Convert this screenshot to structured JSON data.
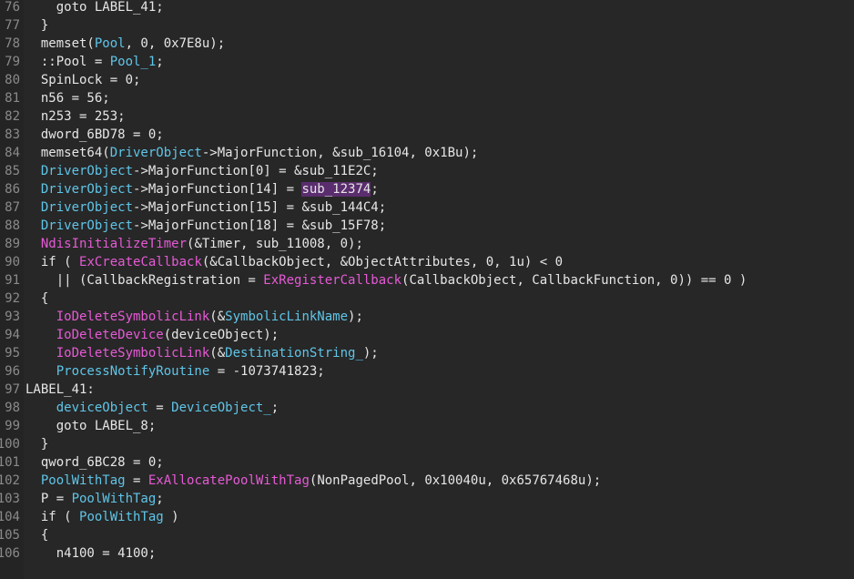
{
  "colors": {
    "background": "#272727",
    "plain": "#e6e6e6",
    "variable": "#5fc5e8",
    "function": "#e65ad6",
    "highlight": "#5a2d6e",
    "line_number": "#8a8a8a"
  },
  "lines": [
    {
      "n": "76",
      "tokens": [
        {
          "t": "    goto LABEL_41;",
          "c": "txt"
        }
      ]
    },
    {
      "n": "77",
      "tokens": [
        {
          "t": "  }",
          "c": "txt"
        }
      ]
    },
    {
      "n": "78",
      "tokens": [
        {
          "t": "  memset(",
          "c": "txt"
        },
        {
          "t": "Pool",
          "c": "var"
        },
        {
          "t": ", 0, 0x7E8u);",
          "c": "txt"
        }
      ]
    },
    {
      "n": "79",
      "tokens": [
        {
          "t": "  ::Pool = ",
          "c": "txt"
        },
        {
          "t": "Pool_1",
          "c": "var"
        },
        {
          "t": ";",
          "c": "txt"
        }
      ]
    },
    {
      "n": "80",
      "tokens": [
        {
          "t": "  SpinLock = 0;",
          "c": "txt"
        }
      ]
    },
    {
      "n": "81",
      "tokens": [
        {
          "t": "  n56 = 56;",
          "c": "txt"
        }
      ]
    },
    {
      "n": "82",
      "tokens": [
        {
          "t": "  n253 = 253;",
          "c": "txt"
        }
      ]
    },
    {
      "n": "83",
      "tokens": [
        {
          "t": "  dword_6BD78 = 0;",
          "c": "txt"
        }
      ]
    },
    {
      "n": "84",
      "tokens": [
        {
          "t": "  memset64(",
          "c": "txt"
        },
        {
          "t": "DriverObject",
          "c": "var"
        },
        {
          "t": "->MajorFunction, &sub_16104, 0x1Bu);",
          "c": "txt"
        }
      ]
    },
    {
      "n": "85",
      "tokens": [
        {
          "t": "  ",
          "c": "txt"
        },
        {
          "t": "DriverObject",
          "c": "var"
        },
        {
          "t": "->MajorFunction[0] = &sub_11E2C;",
          "c": "txt"
        }
      ]
    },
    {
      "n": "86",
      "tokens": [
        {
          "t": "  ",
          "c": "txt"
        },
        {
          "t": "DriverObject",
          "c": "var"
        },
        {
          "t": "->MajorFunction[14] = ",
          "c": "txt"
        },
        {
          "t": "sub_12374",
          "c": "hl"
        },
        {
          "t": ";",
          "c": "txt"
        }
      ]
    },
    {
      "n": "87",
      "tokens": [
        {
          "t": "  ",
          "c": "txt"
        },
        {
          "t": "DriverObject",
          "c": "var"
        },
        {
          "t": "->MajorFunction[15] = &sub_144C4;",
          "c": "txt"
        }
      ]
    },
    {
      "n": "88",
      "tokens": [
        {
          "t": "  ",
          "c": "txt"
        },
        {
          "t": "DriverObject",
          "c": "var"
        },
        {
          "t": "->MajorFunction[18] = &sub_15F78;",
          "c": "txt"
        }
      ]
    },
    {
      "n": "89",
      "tokens": [
        {
          "t": "  ",
          "c": "txt"
        },
        {
          "t": "NdisInitializeTimer",
          "c": "func"
        },
        {
          "t": "(&Timer, sub_11008, 0);",
          "c": "txt"
        }
      ]
    },
    {
      "n": "90",
      "tokens": [
        {
          "t": "  if ( ",
          "c": "txt"
        },
        {
          "t": "ExCreateCallback",
          "c": "func"
        },
        {
          "t": "(&CallbackObject, &ObjectAttributes, 0, 1u) < 0",
          "c": "txt"
        }
      ]
    },
    {
      "n": "91",
      "tokens": [
        {
          "t": "    || (CallbackRegistration = ",
          "c": "txt"
        },
        {
          "t": "ExRegisterCallback",
          "c": "func"
        },
        {
          "t": "(CallbackObject, CallbackFunction, 0)) == 0 )",
          "c": "txt"
        }
      ]
    },
    {
      "n": "92",
      "tokens": [
        {
          "t": "  {",
          "c": "txt"
        }
      ]
    },
    {
      "n": "93",
      "tokens": [
        {
          "t": "    ",
          "c": "txt"
        },
        {
          "t": "IoDeleteSymbolicLink",
          "c": "func"
        },
        {
          "t": "(&",
          "c": "txt"
        },
        {
          "t": "SymbolicLinkName",
          "c": "var"
        },
        {
          "t": ");",
          "c": "txt"
        }
      ]
    },
    {
      "n": "94",
      "tokens": [
        {
          "t": "    ",
          "c": "txt"
        },
        {
          "t": "IoDeleteDevice",
          "c": "func"
        },
        {
          "t": "(deviceObject);",
          "c": "txt"
        }
      ]
    },
    {
      "n": "95",
      "tokens": [
        {
          "t": "    ",
          "c": "txt"
        },
        {
          "t": "IoDeleteSymbolicLink",
          "c": "func"
        },
        {
          "t": "(&",
          "c": "txt"
        },
        {
          "t": "DestinationString_",
          "c": "var"
        },
        {
          "t": ");",
          "c": "txt"
        }
      ]
    },
    {
      "n": "96",
      "tokens": [
        {
          "t": "    ",
          "c": "txt"
        },
        {
          "t": "ProcessNotifyRoutine",
          "c": "var"
        },
        {
          "t": " = -1073741823;",
          "c": "txt"
        }
      ]
    },
    {
      "n": "97",
      "tokens": [
        {
          "t": "LABEL_41:",
          "c": "txt"
        }
      ]
    },
    {
      "n": "98",
      "tokens": [
        {
          "t": "    ",
          "c": "txt"
        },
        {
          "t": "deviceObject",
          "c": "var"
        },
        {
          "t": " = ",
          "c": "txt"
        },
        {
          "t": "DeviceObject_",
          "c": "var"
        },
        {
          "t": ";",
          "c": "txt"
        }
      ]
    },
    {
      "n": "99",
      "tokens": [
        {
          "t": "    goto LABEL_8;",
          "c": "txt"
        }
      ]
    },
    {
      "n": "100",
      "tokens": [
        {
          "t": "  }",
          "c": "txt"
        }
      ]
    },
    {
      "n": "101",
      "tokens": [
        {
          "t": "  qword_6BC28 = 0;",
          "c": "txt"
        }
      ]
    },
    {
      "n": "102",
      "tokens": [
        {
          "t": "  ",
          "c": "txt"
        },
        {
          "t": "PoolWithTag",
          "c": "var"
        },
        {
          "t": " = ",
          "c": "txt"
        },
        {
          "t": "ExAllocatePoolWithTag",
          "c": "func"
        },
        {
          "t": "(NonPagedPool, 0x10040u, 0x65767468u);",
          "c": "txt"
        }
      ]
    },
    {
      "n": "103",
      "tokens": [
        {
          "t": "  P = ",
          "c": "txt"
        },
        {
          "t": "PoolWithTag",
          "c": "var"
        },
        {
          "t": ";",
          "c": "txt"
        }
      ]
    },
    {
      "n": "104",
      "tokens": [
        {
          "t": "  if ( ",
          "c": "txt"
        },
        {
          "t": "PoolWithTag",
          "c": "var"
        },
        {
          "t": " )",
          "c": "txt"
        }
      ]
    },
    {
      "n": "105",
      "tokens": [
        {
          "t": "  {",
          "c": "txt"
        }
      ]
    },
    {
      "n": "106",
      "tokens": [
        {
          "t": "    n4100 = 4100;",
          "c": "txt"
        }
      ]
    }
  ]
}
